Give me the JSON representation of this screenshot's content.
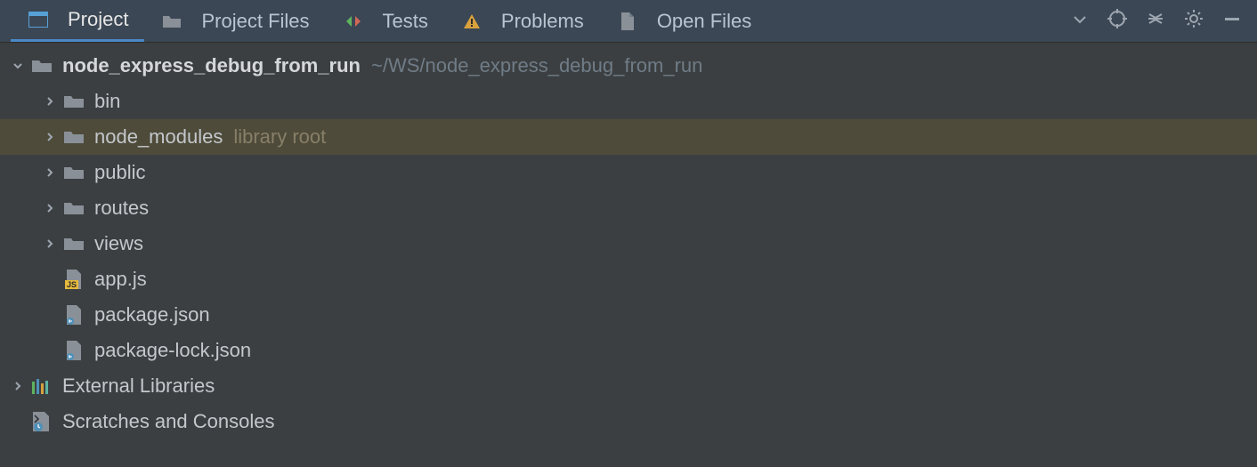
{
  "tabs": {
    "project": "Project",
    "projectFiles": "Project Files",
    "tests": "Tests",
    "problems": "Problems",
    "openFiles": "Open Files"
  },
  "tree": {
    "root": {
      "name": "node_express_debug_from_run",
      "path": "~/WS/node_express_debug_from_run"
    },
    "bin": "bin",
    "nodeModules": {
      "name": "node_modules",
      "hint": "library root"
    },
    "public": "public",
    "routes": "routes",
    "views": "views",
    "appjs": "app.js",
    "pkg": "package.json",
    "pkglock": "package-lock.json",
    "extlib": "External Libraries",
    "scratches": "Scratches and Consoles"
  }
}
